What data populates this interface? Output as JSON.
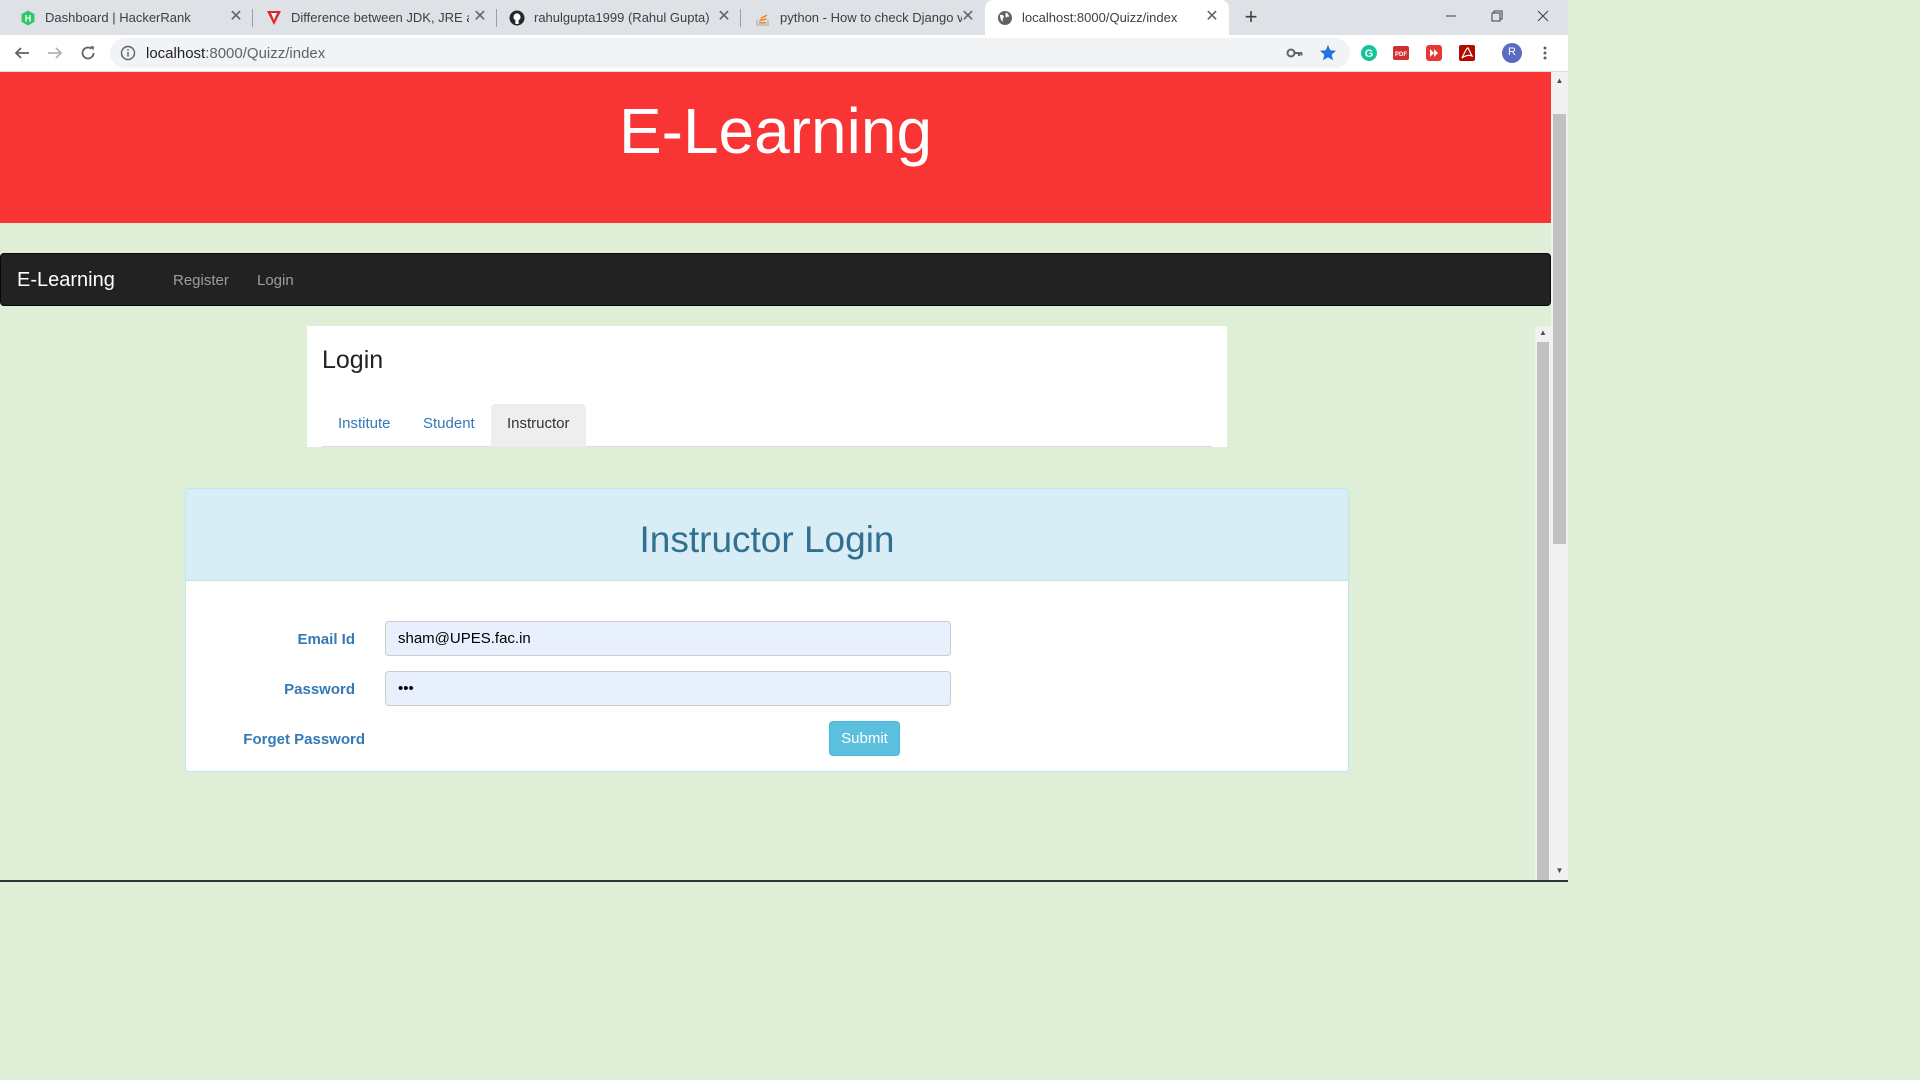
{
  "browser": {
    "tabs": [
      {
        "title": "Dashboard | HackerRank",
        "icon": "hackerrank-icon"
      },
      {
        "title": "Difference between JDK, JRE and",
        "icon": "vivid-icon"
      },
      {
        "title": "rahulgupta1999 (Rahul Gupta)",
        "icon": "github-icon"
      },
      {
        "title": "python - How to check Django v",
        "icon": "stackoverflow-icon"
      },
      {
        "title": "localhost:8000/Quizz/index",
        "icon": "globe-icon"
      }
    ],
    "close_glyph": "✕",
    "new_tab_glyph": "+",
    "url_host": "localhost",
    "url_rest": ":8000/Quizz/index",
    "profile_initial": "R"
  },
  "page": {
    "hero_title": "E-Learning",
    "navbar": {
      "brand": "E-Learning",
      "links": [
        "Register",
        "Login"
      ]
    },
    "login": {
      "heading": "Login",
      "tabs": [
        "Institute",
        "Student",
        "Instructor"
      ],
      "active_tab": "Instructor"
    },
    "form": {
      "title": "Instructor Login",
      "email_label": "Email Id",
      "email_value": "sham@UPES.fac.in",
      "password_label": "Password",
      "password_value": "•••",
      "forget_label": "Forget Password",
      "submit_label": "Submit"
    }
  },
  "colors": {
    "hero": "#f93434",
    "page_bg": "#dfeed6",
    "navbar": "#222222",
    "card_head": "#d9edf7",
    "submit": "#5bc0de"
  }
}
